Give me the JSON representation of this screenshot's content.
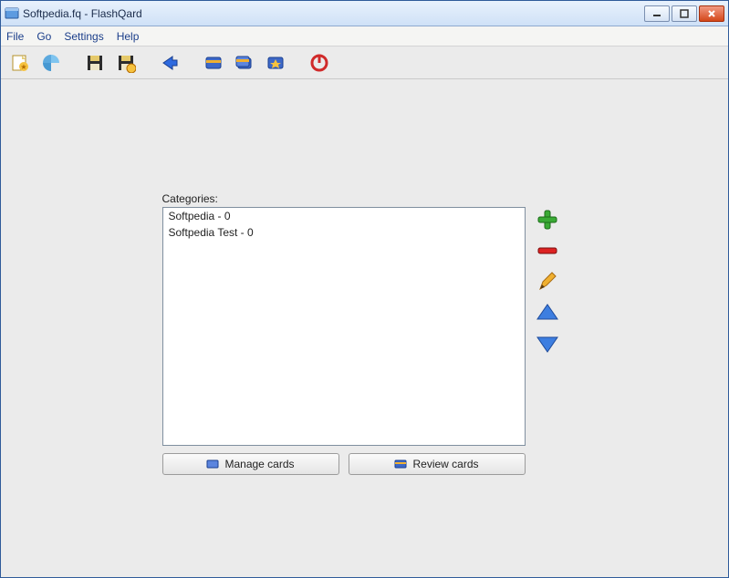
{
  "window": {
    "title": "Softpedia.fq - FlashQard"
  },
  "menubar": {
    "file": "File",
    "go": "Go",
    "settings": "Settings",
    "help": "Help"
  },
  "toolbar": {
    "new": "new",
    "open": "open",
    "save": "save",
    "saveas": "saveas",
    "back": "back",
    "card1": "card1",
    "card2": "card2",
    "card3": "card3",
    "power": "power"
  },
  "main": {
    "categories_label": "Categories:",
    "items": [
      {
        "text": "Softpedia   -   0"
      },
      {
        "text": "Softpedia Test   -   0"
      }
    ],
    "manage_btn": "Manage cards",
    "review_btn": "Review cards"
  },
  "side": {
    "add": "+",
    "remove": "-",
    "edit": "edit",
    "up": "▲",
    "down": "▼"
  }
}
